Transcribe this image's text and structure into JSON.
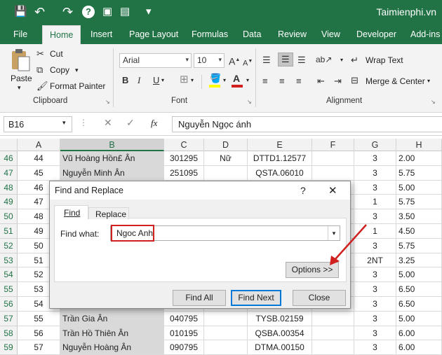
{
  "quick_access": {
    "save_icon": "💾",
    "undo_icon": "↶",
    "redo_icon": "↷",
    "help_icon": "?",
    "image_icon": "▣",
    "form_icon": "▤",
    "more_icon": "▾"
  },
  "brand": "Taimienphi.vn",
  "tabs": [
    "File",
    "Home",
    "Insert",
    "Page Layout",
    "Formulas",
    "Data",
    "Review",
    "View",
    "Developer",
    "Add-ins"
  ],
  "clipboard": {
    "paste": "Paste",
    "cut": "Cut",
    "copy": "Copy",
    "format_painter": "Format Painter",
    "label": "Clipboard"
  },
  "font": {
    "name": "Arial",
    "size": "10",
    "bold": "B",
    "italic": "I",
    "underline": "U",
    "label": "Font",
    "font_color": "A"
  },
  "alignment": {
    "wrap": "Wrap Text",
    "merge": "Merge & Center",
    "label": "Alignment"
  },
  "namebox": "B16",
  "formula_fx": "fx",
  "formula_value": "Nguyễn Ngọc ánh",
  "columns": [
    "A",
    "B",
    "C",
    "D",
    "E",
    "F",
    "G",
    "H"
  ],
  "rows": [
    {
      "n": "46",
      "a": "44",
      "b": "Vũ Hoàng Hồn£ Ân",
      "c": "301295",
      "d": "Nữ",
      "e": "DTTD1.12577",
      "g": "3",
      "h": "2.00"
    },
    {
      "n": "47",
      "a": "45",
      "b": "Nguyễn Minh Ân",
      "c": "251095",
      "d": "",
      "e": "QSTA.06010",
      "g": "3",
      "h": "5.75"
    },
    {
      "n": "48",
      "a": "46",
      "b": "",
      "c": "",
      "d": "",
      "e": "",
      "g": "3",
      "h": "5.00"
    },
    {
      "n": "49",
      "a": "47",
      "b": "",
      "c": "",
      "d": "",
      "e": "",
      "g": "1",
      "h": "5.75"
    },
    {
      "n": "50",
      "a": "48",
      "b": "",
      "c": "",
      "d": "",
      "e": "",
      "g": "3",
      "h": "3.50"
    },
    {
      "n": "51",
      "a": "49",
      "b": "",
      "c": "",
      "d": "",
      "e": "",
      "g": "1",
      "h": "4.50"
    },
    {
      "n": "52",
      "a": "50",
      "b": "",
      "c": "",
      "d": "",
      "e": "",
      "g": "3",
      "h": "5.75"
    },
    {
      "n": "53",
      "a": "51",
      "b": "",
      "c": "",
      "d": "",
      "e": "",
      "g": "2NT",
      "h": "3.25"
    },
    {
      "n": "54",
      "a": "52",
      "b": "",
      "c": "",
      "d": "",
      "e": "",
      "g": "3",
      "h": "5.00"
    },
    {
      "n": "55",
      "a": "53",
      "b": "",
      "c": "",
      "d": "",
      "e": "",
      "g": "3",
      "h": "6.50"
    },
    {
      "n": "56",
      "a": "54",
      "b": "",
      "c": "",
      "d": "",
      "e": "",
      "g": "3",
      "h": "6.50"
    },
    {
      "n": "57",
      "a": "55",
      "b": "Trần Gia Ân",
      "c": "040795",
      "d": "",
      "e": "TYSB.02159",
      "g": "3",
      "h": "5.00"
    },
    {
      "n": "58",
      "a": "56",
      "b": "Trần Hồ Thiên Ân",
      "c": "010195",
      "d": "",
      "e": "QSBA.00354",
      "g": "3",
      "h": "6.00"
    },
    {
      "n": "59",
      "a": "57",
      "b": "Nguyễn Hoàng Ân",
      "c": "090795",
      "d": "",
      "e": "DTMA.00150",
      "g": "3",
      "h": "6.00"
    }
  ],
  "dialog": {
    "title": "Find and Replace",
    "help": "?",
    "close": "✕",
    "tab_find": "Find",
    "tab_replace": "Replace",
    "find_what_label": "Find what:",
    "find_value": "Ngoc Anh",
    "options_button": "Options >>",
    "find_all": "Find All",
    "find_next": "Find Next",
    "close_button": "Close"
  },
  "colors": {
    "excel_green": "#217346",
    "highlight_red": "#d0201f"
  }
}
